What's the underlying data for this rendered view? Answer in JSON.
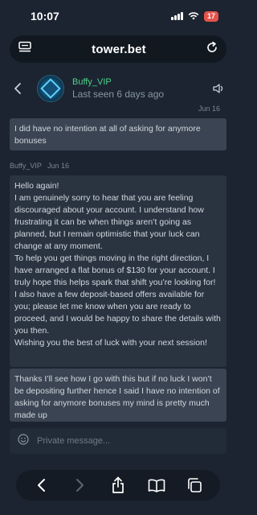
{
  "status": {
    "time": "10:07",
    "battery": "17"
  },
  "browser": {
    "url": "tower.bet"
  },
  "chat": {
    "contact_name": "Buffy_VIP",
    "last_seen": "Last seen 6 days ago",
    "messages": [
      {
        "sender": "me",
        "date": "Jun 16",
        "text": "I did have no intention at all of asking for anymore bonuses"
      },
      {
        "sender": "Buffy_VIP",
        "date": "Jun 16",
        "text": "Hello again!\nI am genuinely sorry to hear that you are feeling discouraged about your account. I understand how frustrating it can be when things aren’t going as planned, but I remain optimistic that your luck can change at any moment.\nTo help you get things moving in the right direction, I have arranged a flat bonus of $130 for your account. I truly hope this helps spark that shift you’re looking for!\nI also have a few deposit-based offers available for you; please let me know when you are ready to proceed, and I would be happy to share the details with you then.\nWishing you the best of luck with your next session!"
      },
      {
        "sender": "me",
        "text": "Thanks I’ll see how I go with this but if no luck I won’t be depositing further hence I said I have no intention of asking for anymore bonuses my mind is pretty much made up"
      }
    ]
  },
  "composer": {
    "placeholder": "Private message..."
  },
  "colors": {
    "background": "#1b2430",
    "accent_green": "#4fd18b",
    "battery_red": "#e5534b"
  }
}
